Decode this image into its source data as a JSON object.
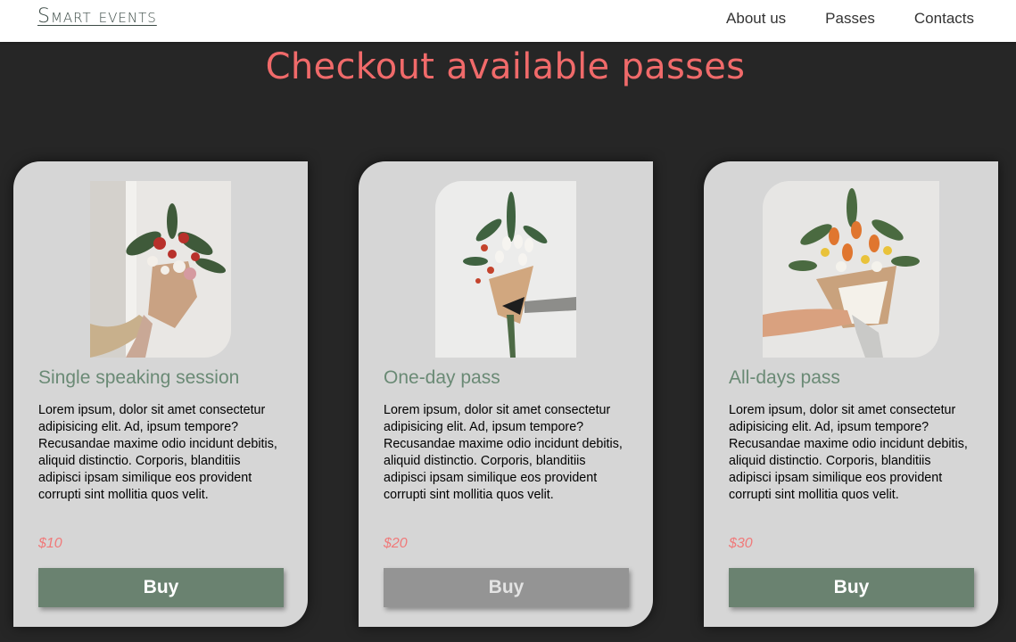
{
  "nav": {
    "logo": "Smart events",
    "links": [
      "About us",
      "Passes",
      "Contacts"
    ]
  },
  "title": "Checkout available passes",
  "passes": [
    {
      "name": "Single speaking session",
      "description": "Lorem ipsum, dolor sit amet consectetur adipisicing elit. Ad, ipsum tempore? Recusandae maxime odio incidunt debitis, aliquid distinctio. Corporis, blanditiis adipisci ipsam similique eos provident corrupti sint mollitia quos velit.",
      "price": "$10",
      "button_label": "Buy",
      "button_color": "#6a8270",
      "button_text_color": "#ffffff",
      "image_icon": "flower-bouquet-red-image"
    },
    {
      "name": "One-day pass",
      "description": "Lorem ipsum, dolor sit amet consectetur adipisicing elit. Ad, ipsum tempore? Recusandae maxime odio incidunt debitis, aliquid distinctio. Corporis, blanditiis adipisci ipsam similique eos provident corrupti sint mollitia quos velit.",
      "price": "$20",
      "button_label": "Buy",
      "button_color": "#949494",
      "button_text_color": "#e3e3e3",
      "image_icon": "flower-bouquet-white-image"
    },
    {
      "name": "All-days pass",
      "description": "Lorem ipsum, dolor sit amet consectetur adipisicing elit. Ad, ipsum tempore? Recusandae maxime odio incidunt debitis, aliquid distinctio. Corporis, blanditiis adipisci ipsam similique eos provident corrupti sint mollitia quos velit.",
      "price": "$30",
      "button_label": "Buy",
      "button_color": "#6a8270",
      "button_text_color": "#ffffff",
      "image_icon": "flower-bouquet-orange-image"
    }
  ],
  "colors": {
    "background": "#262626",
    "accent_title": "#f06a6a",
    "card": "#d6d6d6",
    "pass_name": "#6a8a75",
    "price": "#f07a7a"
  }
}
